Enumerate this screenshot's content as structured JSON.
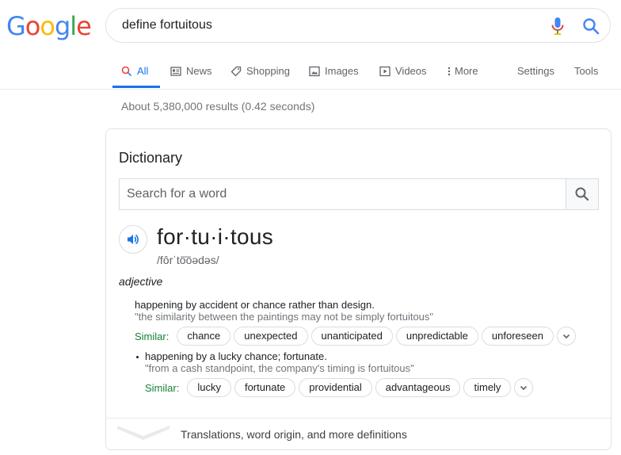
{
  "logo": {
    "letters": [
      "G",
      "o",
      "o",
      "g",
      "l",
      "e"
    ],
    "colors": [
      "#4285F4",
      "#EA4335",
      "#FBBC05",
      "#4285F4",
      "#34A853",
      "#EA4335"
    ]
  },
  "search": {
    "query": "define fortuitous"
  },
  "tabs": [
    {
      "label": "All",
      "icon": "search-icon"
    },
    {
      "label": "News",
      "icon": "news-icon"
    },
    {
      "label": "Shopping",
      "icon": "tag-icon"
    },
    {
      "label": "Images",
      "icon": "image-icon"
    },
    {
      "label": "Videos",
      "icon": "play-icon"
    },
    {
      "label": "More",
      "icon": "kebab-icon"
    }
  ],
  "tools": {
    "settings": "Settings",
    "tools": "Tools"
  },
  "stats": "About 5,380,000 results (0.42 seconds)",
  "dictionary": {
    "title": "Dictionary",
    "search_placeholder": "Search for a word",
    "headword": "for·tu·i·tous",
    "phonetic": "/fôrˈto͞oədəs/",
    "part_of_speech": "adjective",
    "senses": [
      {
        "definition": "happening by accident or chance rather than design.",
        "example": "\"the similarity between the paintings may not be simply fortuitous\"",
        "similar_label": "Similar:",
        "similar": [
          "chance",
          "unexpected",
          "unanticipated",
          "unpredictable",
          "unforeseen"
        ]
      },
      {
        "definition": "happening by a lucky chance; fortunate.",
        "example": "\"from a cash standpoint, the company's timing is fortuitous\"",
        "similar_label": "Similar:",
        "similar": [
          "lucky",
          "fortunate",
          "providential",
          "advantageous",
          "timely"
        ]
      }
    ],
    "footer": "Translations, word origin, and more definitions"
  },
  "colors": {
    "accent": "#1a73e8",
    "similar_label": "#188038"
  }
}
